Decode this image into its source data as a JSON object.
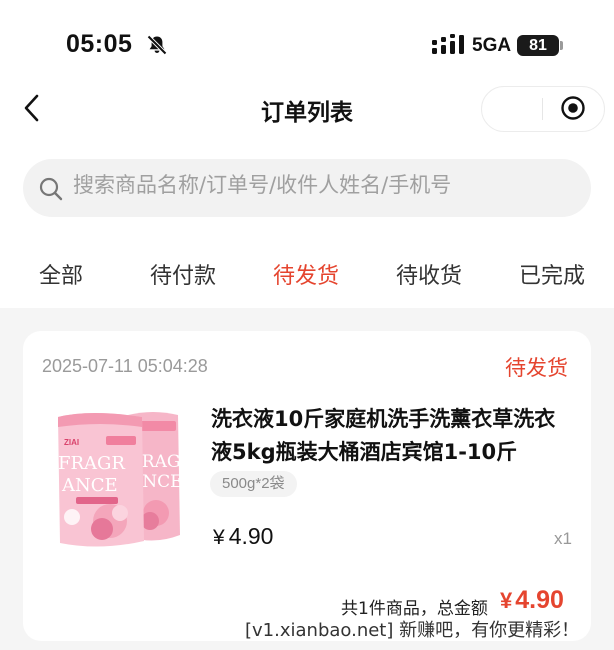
{
  "status_bar": {
    "time": "05:05",
    "network": "5GA",
    "battery": "81"
  },
  "nav": {
    "title": "订单列表"
  },
  "search": {
    "placeholder": "搜索商品名称/订单号/收件人姓名/手机号"
  },
  "tabs": [
    {
      "label": "全部",
      "active": false
    },
    {
      "label": "待付款",
      "active": false
    },
    {
      "label": "待发货",
      "active": true
    },
    {
      "label": "待收货",
      "active": false
    },
    {
      "label": "已完成",
      "active": false
    }
  ],
  "order": {
    "time": "2025-07-11 05:04:28",
    "status": "待发货",
    "product": {
      "name": "洗衣液10斤家庭机洗手洗薰衣草洗衣液5kg瓶装大桶酒店宾馆1-10斤",
      "spec": "500g*2袋",
      "price_symbol": "¥",
      "price": "4.90",
      "quantity": "x1",
      "image_text": {
        "brand": "ZIAI",
        "line1": "FRAGR",
        "line2": "ANCE",
        "back_line1": "FRAG",
        "back_line2": "ANCE"
      }
    },
    "summary": "共1件商品，总金额",
    "total_symbol": "¥",
    "total": "4.90"
  },
  "watermark": "[v1.xianbao.net] 新赚吧，有你更精彩！",
  "colors": {
    "accent": "#e5452f",
    "background": "#f5f5f5"
  }
}
